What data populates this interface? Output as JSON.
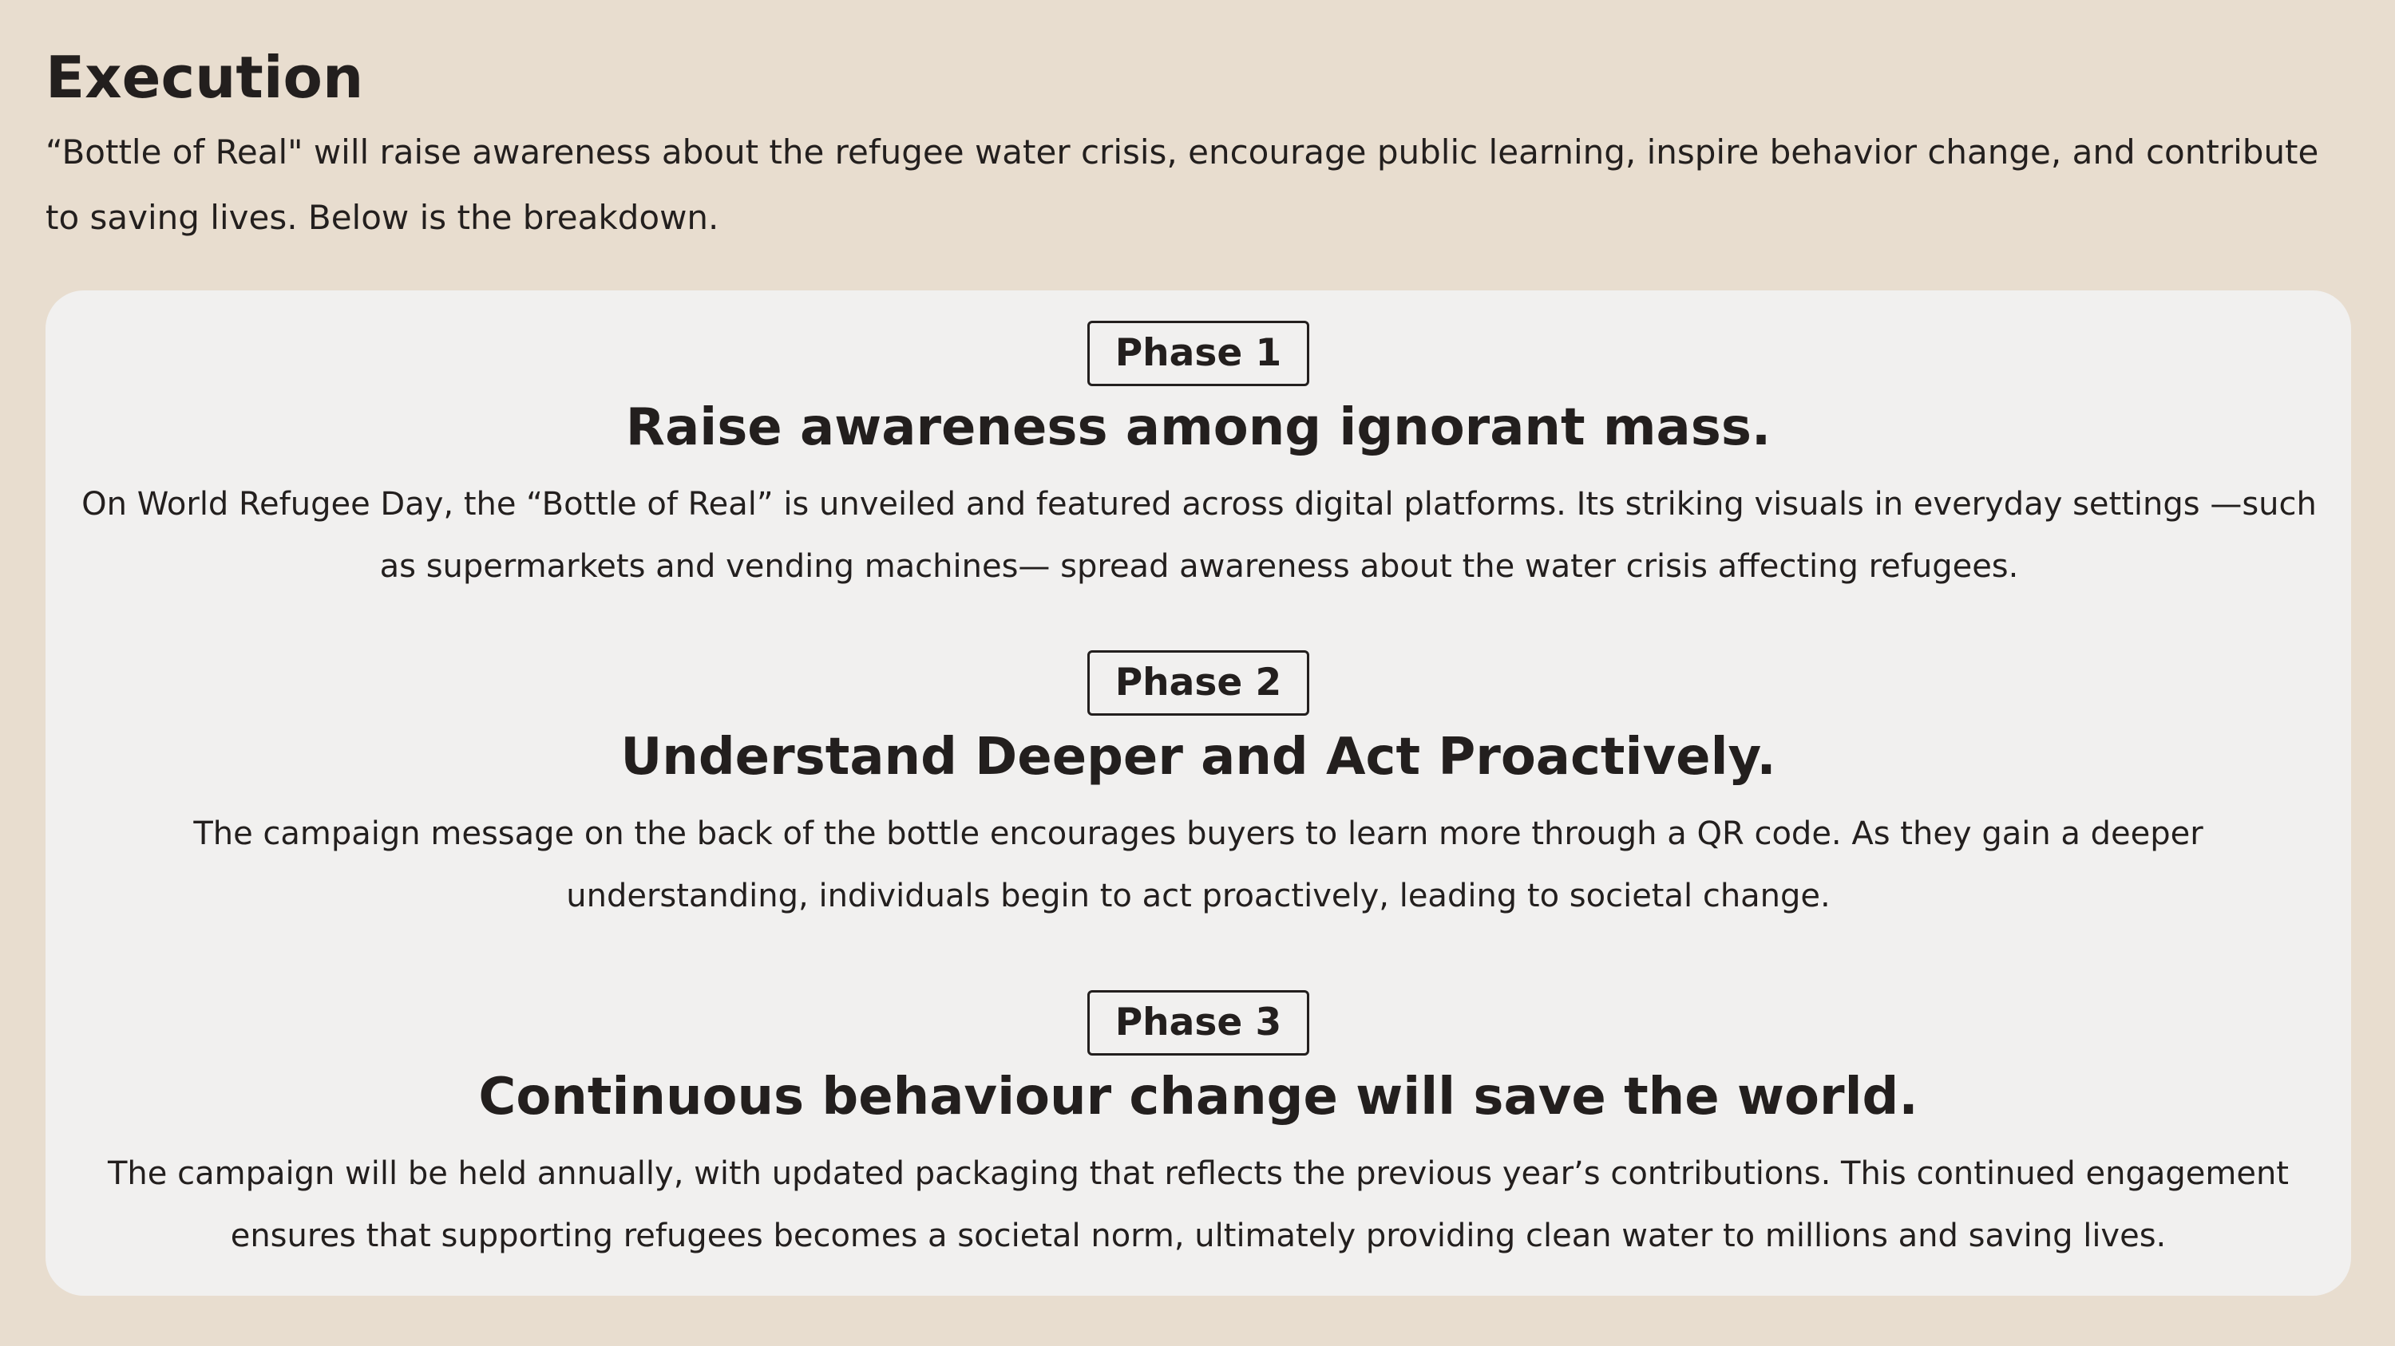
{
  "header": {
    "title": "Execution",
    "intro": "“Bottle of Real\" will raise awareness about the refugee water crisis, encourage public learning, inspire behavior change, and contribute to saving lives. Below is the breakdown."
  },
  "phases": [
    {
      "badge": "Phase 1",
      "heading": "Raise awareness among ignorant mass.",
      "body": "On World Refugee Day, the “Bottle of Real” is unveiled and featured across digital platforms. Its striking visuals in everyday settings —such as supermarkets and vending machines— spread awareness about the water crisis affecting refugees."
    },
    {
      "badge": "Phase 2",
      "heading": "Understand Deeper and Act Proactively.",
      "body": "The campaign message on the back of the bottle encourages buyers to learn more through a QR code. As they gain a deeper understanding, individuals begin to act proactively, leading to societal change."
    },
    {
      "badge": "Phase 3",
      "heading": "Continuous behaviour change will save the world.",
      "body": "The campaign will be held annually, with updated packaging that reflects the previous year’s contributions. This continued engagement ensures that supporting refugees becomes a societal norm, ultimately providing clean water to millions and saving lives."
    }
  ],
  "colors": {
    "background": "#e8ddcf",
    "card": "#f1f0ef",
    "text": "#231f1e"
  }
}
